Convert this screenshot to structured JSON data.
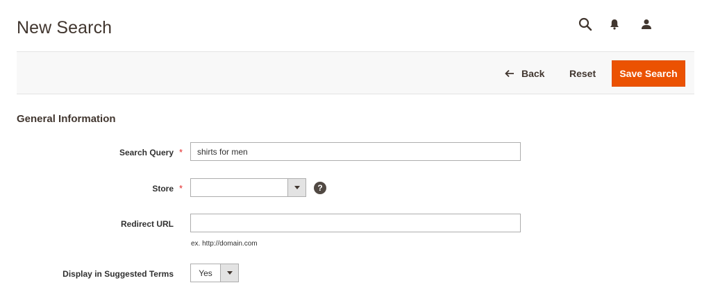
{
  "page": {
    "title": "New Search"
  },
  "header": {
    "icons": [
      "search-icon",
      "bell-icon",
      "user-icon"
    ]
  },
  "actions": {
    "back_label": "Back",
    "reset_label": "Reset",
    "save_label": "Save Search"
  },
  "section": {
    "title": "General Information"
  },
  "form": {
    "search_query": {
      "label": "Search Query",
      "required_mark": "*",
      "value": "shirts for men"
    },
    "store": {
      "label": "Store",
      "required_mark": "*",
      "value": ""
    },
    "redirect_url": {
      "label": "Redirect URL",
      "value": "",
      "note": "ex. http://domain.com"
    },
    "display_in_suggested_terms": {
      "label": "Display in Suggested Terms",
      "value": "Yes"
    }
  },
  "colors": {
    "primary_button": "#eb5202",
    "required_star": "#e22626",
    "text_dark": "#41362f"
  }
}
